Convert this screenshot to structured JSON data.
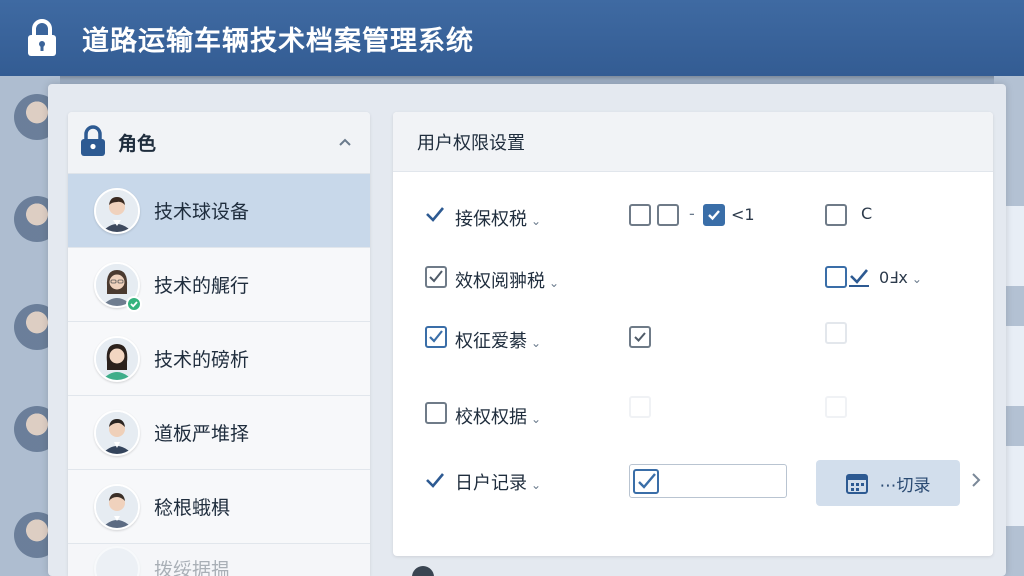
{
  "header": {
    "title": "道路运输车辆技术档案管理系统",
    "icon": "lock-icon",
    "bg_color": "#3a6399"
  },
  "left_panel": {
    "title": "角色",
    "roles": [
      {
        "name": "技术球设备",
        "selected": true
      },
      {
        "name": "技术的艉行",
        "selected": false,
        "badge": "check"
      },
      {
        "name": "技术的磅析",
        "selected": false
      },
      {
        "name": "道板严堆择",
        "selected": false
      },
      {
        "name": "稔根蛾椇",
        "selected": false
      },
      {
        "name": "拨绥据揾",
        "selected": false
      }
    ]
  },
  "right_panel": {
    "title": "用户权限设置",
    "permissions": [
      {
        "label": "接保权税",
        "mark": "check",
        "extra_text": "<1",
        "extra_text2": "C"
      },
      {
        "label": "效权阅翀税",
        "mark": "checkbox-checked",
        "extra_text": "0Ⅎx"
      },
      {
        "label": "权征爱綦",
        "mark": "checkbox-checked-blue"
      },
      {
        "label": "校权权据",
        "mark": "checkbox"
      },
      {
        "label": "日户记录",
        "mark": "check"
      }
    ],
    "log_button": "⋯切录",
    "accent_color": "#3a6ea8"
  }
}
